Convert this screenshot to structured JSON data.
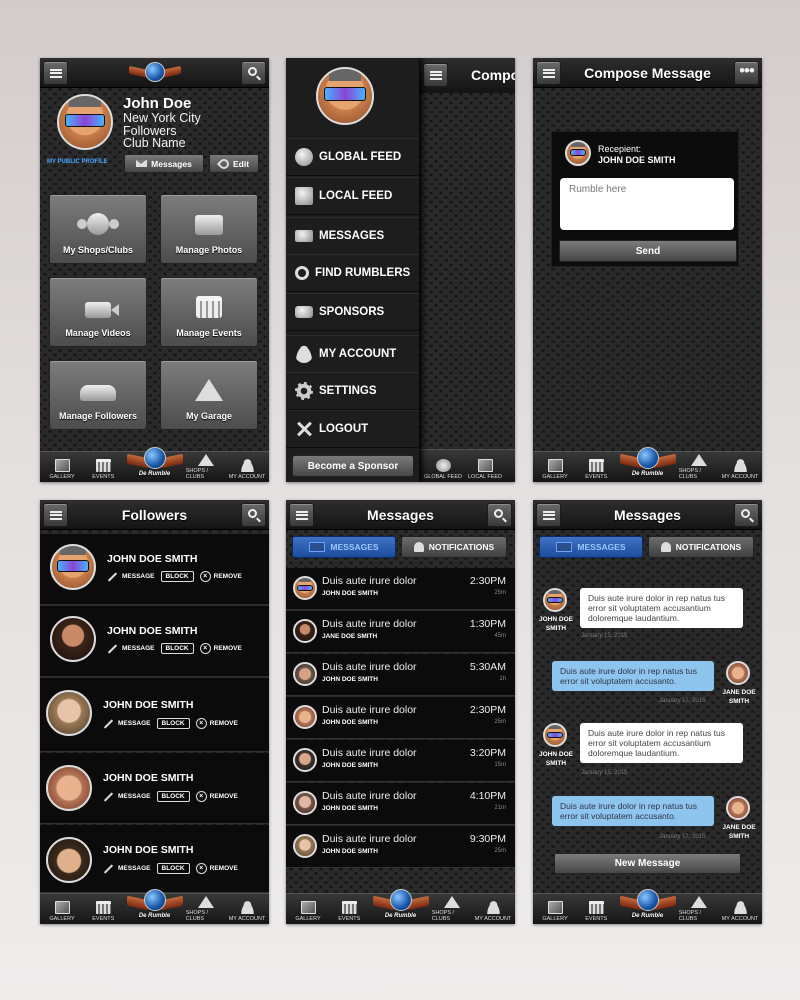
{
  "brand": {
    "logo_text": "De Rumble"
  },
  "tabbar": {
    "gallery": "GALLERY",
    "events": "EVENTS",
    "shops": "SHOPS / CLUBS",
    "account": "MY ACCOUNT",
    "global_feed": "GLOBAL FEED",
    "local_feed": "LOCAL FEED"
  },
  "profile": {
    "name": "John Doe",
    "city": "New York City",
    "followers": "Followers",
    "club": "Club Name",
    "public_profile": "MY PUBLIC PROFILE",
    "messages_btn": "Messages",
    "edit_btn": "Edit",
    "tiles": [
      "My Shops/Clubs",
      "Manage Photos",
      "Manage Videos",
      "Manage Events",
      "Manage Followers",
      "My Garage"
    ]
  },
  "menu": {
    "items": [
      "GLOBAL FEED",
      "LOCAL FEED",
      "MESSAGES",
      "FIND RUMBLERS",
      "SPONSORS",
      "MY ACCOUNT",
      "SETTINGS",
      "LOGOUT"
    ],
    "sponsor_btn": "Become a Sponsor",
    "peek_title": "Compo"
  },
  "compose": {
    "title": "Compose Message",
    "recipient_label": "Recepient:",
    "recipient_name": "JOHN DOE SMITH",
    "placeholder": "Rumble here",
    "send": "Send"
  },
  "followers": {
    "title": "Followers",
    "rows": [
      {
        "name": "JOHN DOE SMITH"
      },
      {
        "name": "JOHN DOE SMITH"
      },
      {
        "name": "JOHN DOE SMITH"
      },
      {
        "name": "JOHN DOE SMITH"
      },
      {
        "name": "JOHN DOE SMITH"
      }
    ],
    "message": "MESSAGE",
    "block": "BLOCK",
    "remove": "REMOVE"
  },
  "messages": {
    "title": "Messages",
    "tab_messages": "MESSAGES",
    "tab_notifications": "NOTIFICATIONS",
    "list": [
      {
        "text": "Duis aute irure dolor",
        "sender": "JOHN DOE SMITH",
        "time": "2:30PM",
        "ago": "25m"
      },
      {
        "text": "Duis aute irure dolor",
        "sender": "JANE DOE SMITH",
        "time": "1:30PM",
        "ago": "45m"
      },
      {
        "text": "Duis aute irure dolor",
        "sender": "JOHN DOE SMITH",
        "time": "5:30AM",
        "ago": "1h"
      },
      {
        "text": "Duis aute irure dolor",
        "sender": "JOHN DOE SMITH",
        "time": "2:30PM",
        "ago": "25m"
      },
      {
        "text": "Duis aute irure dolor",
        "sender": "JOHN DOE SMITH",
        "time": "3:20PM",
        "ago": "15m"
      },
      {
        "text": "Duis aute irure dolor",
        "sender": "JOHN DOE SMITH",
        "time": "4:10PM",
        "ago": "21m"
      },
      {
        "text": "Duis aute irure dolor",
        "sender": "JOHN DOE SMITH",
        "time": "9:30PM",
        "ago": "25m"
      }
    ]
  },
  "thread": {
    "title": "Messages",
    "bubbles": [
      {
        "who": "JOHN DOE SMITH",
        "text": "Duis aute irure dolor in rep natus tus error sit voluptatem accusantium doloremque laudantium.",
        "date": "January 15, 2015",
        "side": "left"
      },
      {
        "who": "JANE DOE SMITH",
        "text": "Duis aute irure dolor in rep natus tus error sit voluptatem accusanto.",
        "date": "January 17, 2015",
        "side": "right"
      },
      {
        "who": "JOHN DOE SMITH",
        "text": "Duis aute irure dolor in rep natus tus error sit voluptatem accusantium doloremque laudantium.",
        "date": "January 15, 2015",
        "side": "left"
      },
      {
        "who": "JANE DOE SMITH",
        "text": "Duis aute irure dolor in rep natus tus error sit voluptatem accusanto.",
        "date": "January 17, 2015",
        "side": "right"
      }
    ],
    "new_message": "New Message"
  }
}
